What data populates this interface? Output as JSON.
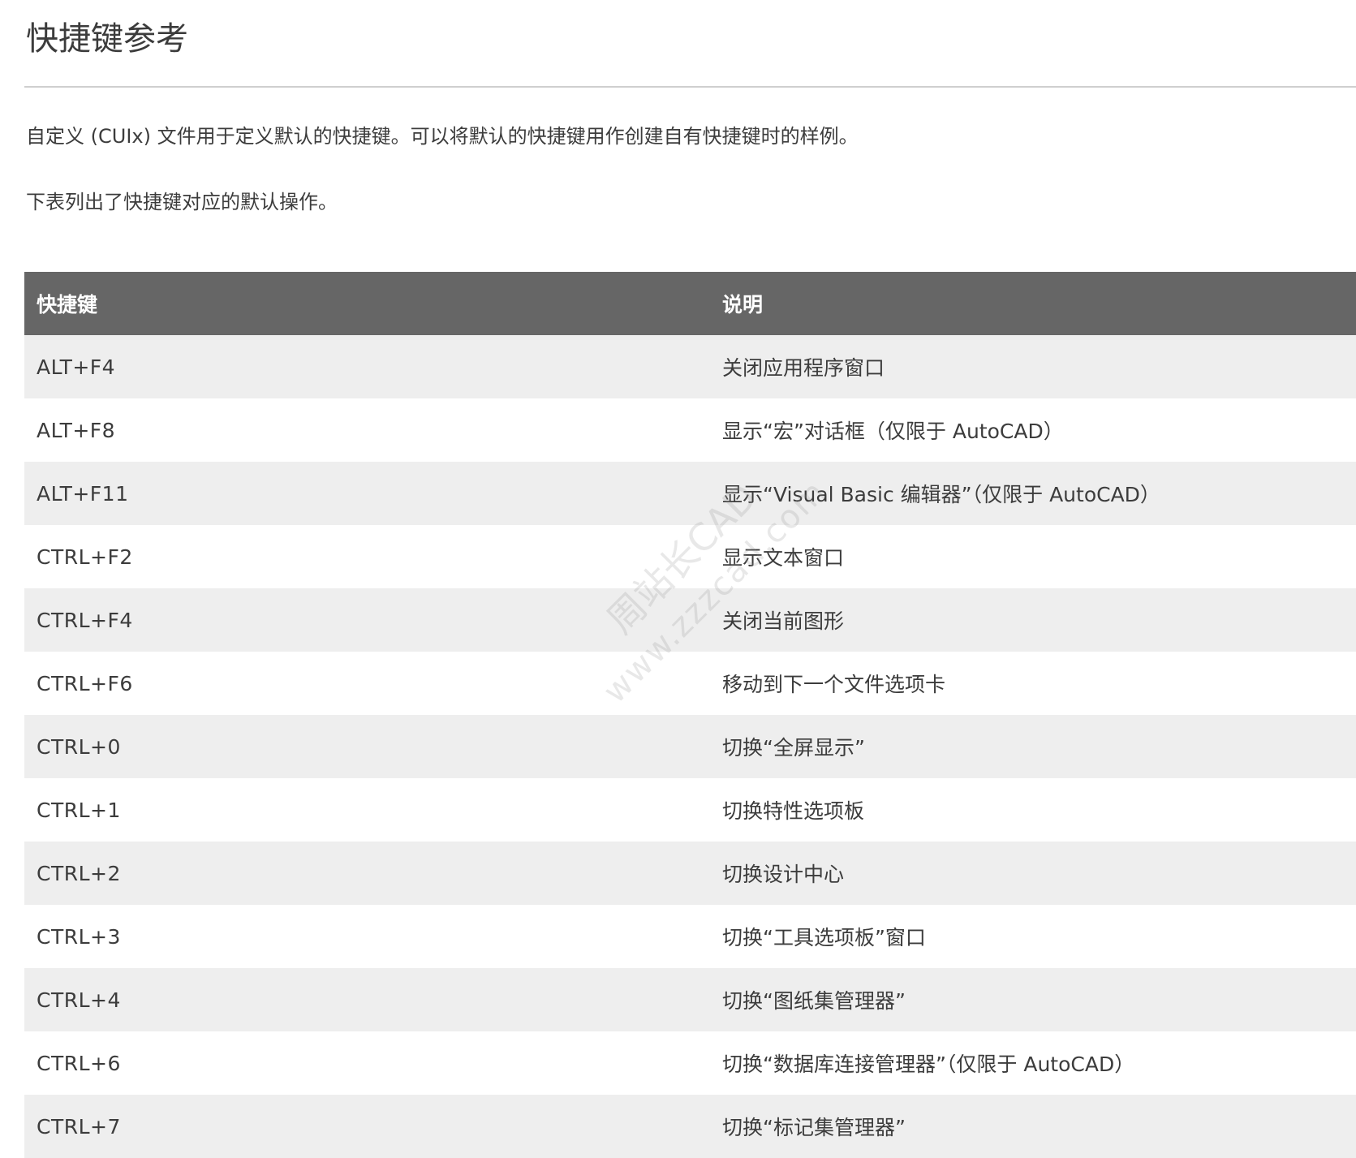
{
  "page": {
    "title": "快捷键参考",
    "intro_1": "自定义 (CUIx) 文件用于定义默认的快捷键。可以将默认的快捷键用作创建自有快捷键时的样例。",
    "intro_2": "下表列出了快捷键对应的默认操作。"
  },
  "table": {
    "headers": [
      "快捷键",
      "说明"
    ],
    "rows": [
      {
        "key": "ALT+F4",
        "desc": "关闭应用程序窗口"
      },
      {
        "key": "ALT+F8",
        "desc": "显示“宏”对话框（仅限于 AutoCAD）"
      },
      {
        "key": "ALT+F11",
        "desc": "显示“Visual Basic 编辑器”（仅限于 AutoCAD）"
      },
      {
        "key": "CTRL+F2",
        "desc": "显示文本窗口"
      },
      {
        "key": "CTRL+F4",
        "desc": "关闭当前图形"
      },
      {
        "key": "CTRL+F6",
        "desc": "移动到下一个文件选项卡"
      },
      {
        "key": "CTRL+0",
        "desc": "切换“全屏显示”"
      },
      {
        "key": "CTRL+1",
        "desc": "切换特性选项板"
      },
      {
        "key": "CTRL+2",
        "desc": "切换设计中心"
      },
      {
        "key": "CTRL+3",
        "desc": "切换“工具选项板”窗口"
      },
      {
        "key": "CTRL+4",
        "desc": "切换“图纸集管理器”"
      },
      {
        "key": "CTRL+6",
        "desc": "切换“数据库连接管理器”（仅限于 AutoCAD）"
      },
      {
        "key": "CTRL+7",
        "desc": "切换“标记集管理器”"
      }
    ]
  },
  "watermark": {
    "line1": "周站长CAD",
    "line2": "www.zzzcad.com"
  },
  "colors": {
    "header_bg": "#666666",
    "stripe_bg": "#eeeeee",
    "text": "#3c3c3c",
    "rule": "#cfcfcf"
  }
}
